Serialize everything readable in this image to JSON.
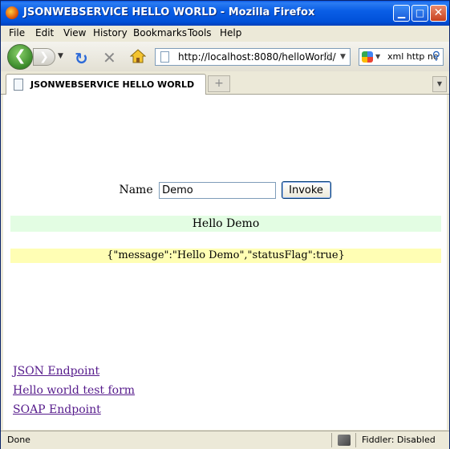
{
  "window": {
    "title": "JSONWEBSERVICE HELLO WORLD - Mozilla Firefox",
    "minimize_glyph": "▁",
    "maximize_glyph": "□",
    "close_glyph": "✕"
  },
  "menu": {
    "items": [
      "File",
      "Edit",
      "View",
      "History",
      "Bookmarks",
      "Tools",
      "Help"
    ]
  },
  "navbar": {
    "back_glyph": "❮",
    "forward_glyph": "❯",
    "dropdown_glyph": "▼",
    "reload_glyph": "↻",
    "stop_glyph": "✕",
    "url": "http://localhost:8080/helloWorld/",
    "bookmark_star": "☆",
    "search_value": "xml http ne",
    "search_glyph": "⚲"
  },
  "tabs": {
    "active_label": "JSONWEBSERVICE HELLO WORLD",
    "new_tab_glyph": "+",
    "list_glyph": "▼"
  },
  "page": {
    "name_label": "Name",
    "name_value": "Demo",
    "invoke_label": "Invoke",
    "hello_result": "Hello Demo",
    "json_result": "{\"message\":\"Hello Demo\",\"statusFlag\":true}",
    "links": [
      "JSON Endpoint",
      "Hello world test form",
      "SOAP Endpoint"
    ]
  },
  "status": {
    "text": "Done",
    "fiddler": "Fiddler: Disabled"
  }
}
